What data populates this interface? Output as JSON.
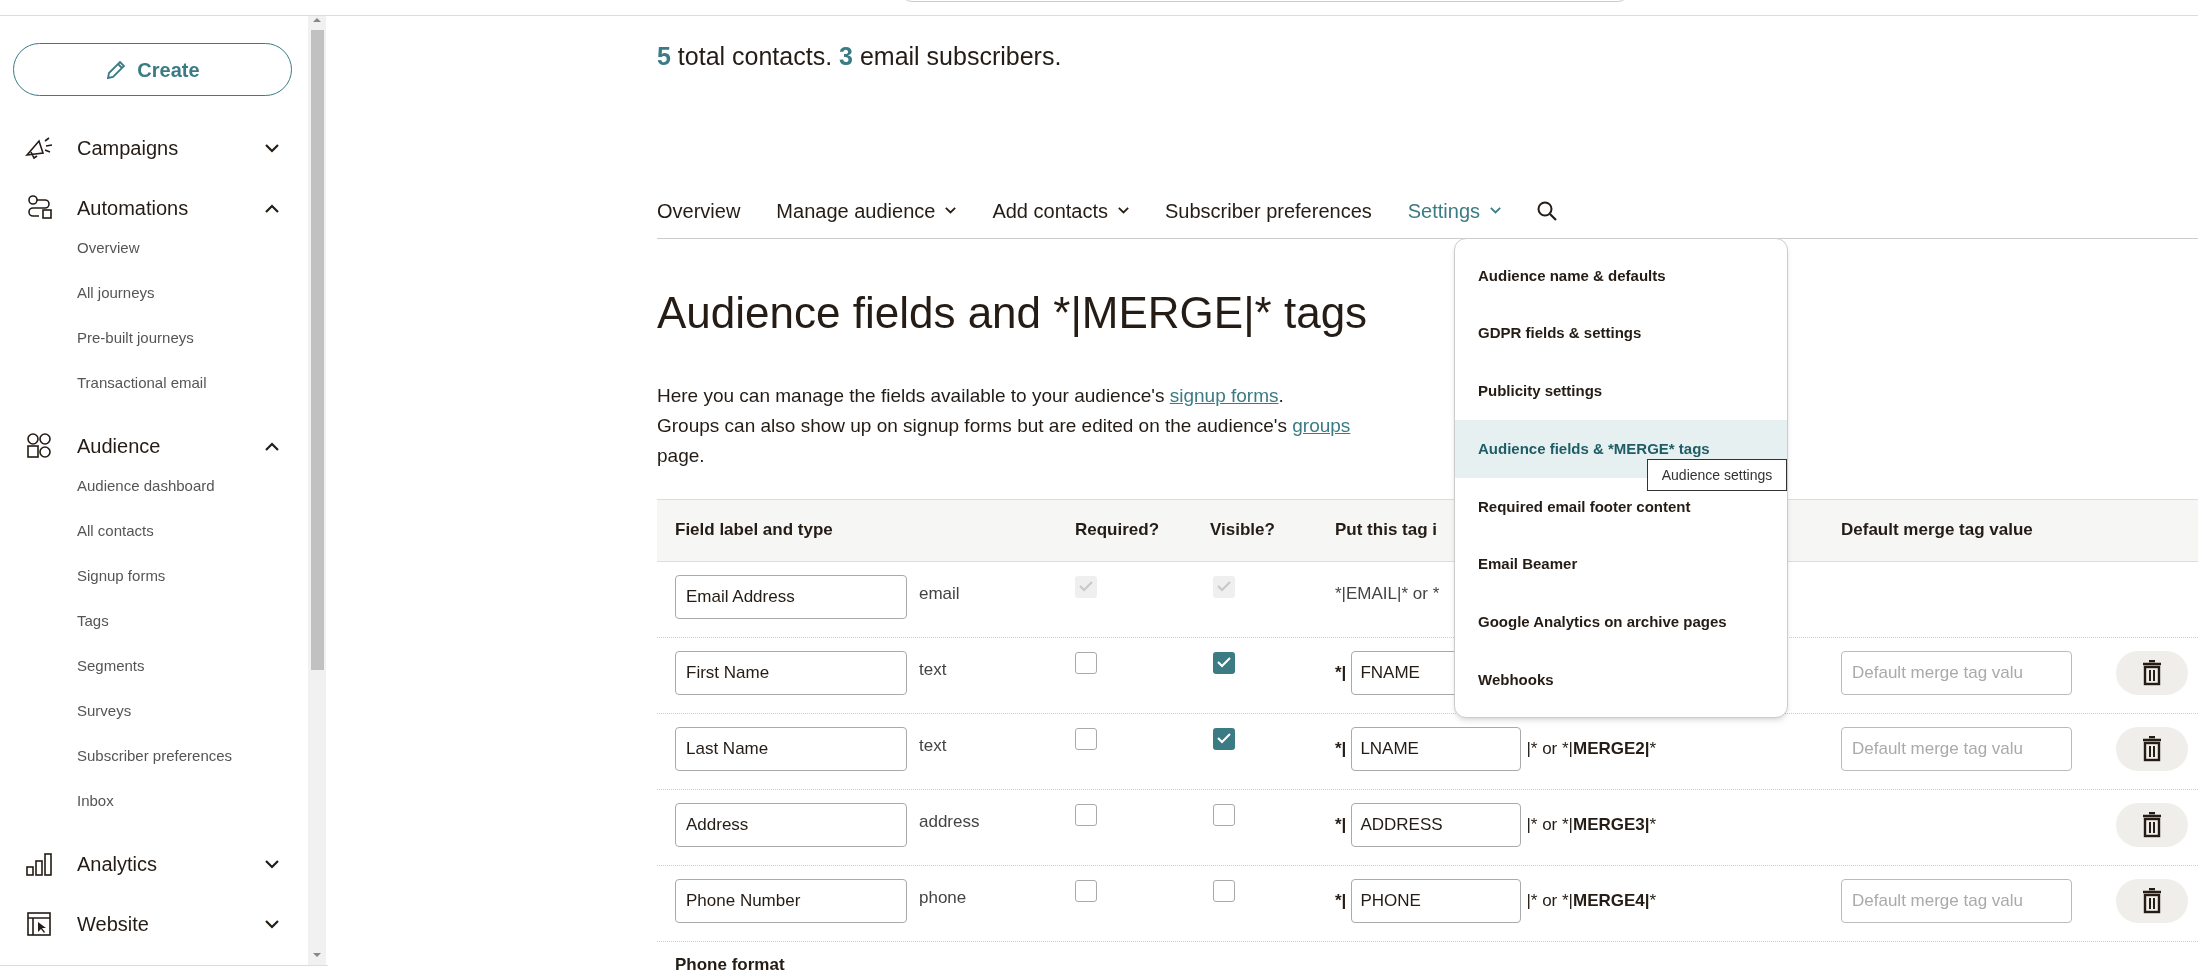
{
  "sidebar": {
    "create_button": "Create",
    "sections": [
      {
        "label": "Campaigns",
        "expanded": false
      },
      {
        "label": "Automations",
        "expanded": true,
        "children": [
          {
            "label": "Overview"
          },
          {
            "label": "All journeys"
          },
          {
            "label": "Pre-built journeys"
          },
          {
            "label": "Transactional email"
          }
        ]
      },
      {
        "label": "Audience",
        "expanded": true,
        "children": [
          {
            "label": "Audience dashboard"
          },
          {
            "label": "All contacts"
          },
          {
            "label": "Signup forms"
          },
          {
            "label": "Tags"
          },
          {
            "label": "Segments"
          },
          {
            "label": "Surveys"
          },
          {
            "label": "Subscriber preferences"
          },
          {
            "label": "Inbox"
          }
        ]
      },
      {
        "label": "Analytics",
        "expanded": false
      },
      {
        "label": "Website",
        "expanded": false
      }
    ]
  },
  "summary": "**5** total contacts. **3** email subscribers.",
  "tabs": [
    {
      "label": "Overview",
      "selected": false,
      "has_menu": false
    },
    {
      "label": "Manage audience",
      "selected": false,
      "has_menu": true
    },
    {
      "label": "Add contacts",
      "selected": false,
      "has_menu": true
    },
    {
      "label": "Subscriber preferences",
      "selected": false,
      "has_menu": false
    },
    {
      "label": "Settings",
      "selected": true,
      "has_menu": true
    }
  ],
  "settings_menu": {
    "items": [
      {
        "label": "Audience name & defaults",
        "selected": false
      },
      {
        "label": "GDPR fields & settings",
        "selected": false
      },
      {
        "label": "Publicity settings",
        "selected": false
      },
      {
        "label": "Audience fields & *MERGE* tags",
        "selected": true
      },
      {
        "label": "Required email footer content",
        "selected": false
      },
      {
        "label": "Email Beamer",
        "selected": false
      },
      {
        "label": "Google Analytics on archive pages",
        "selected": false
      },
      {
        "label": "Webhooks",
        "selected": false
      }
    ],
    "tooltip": "Audience settings"
  },
  "heading": "Audience fields and *|MERGE|* tags",
  "intro": [
    [
      {
        "text": "Here you can manage the fields available to your audience's "
      },
      {
        "text": "signup forms",
        "link": true
      },
      {
        "text": "."
      }
    ],
    [
      {
        "text": "Groups can also show up on signup forms but are edited on the audience's "
      },
      {
        "text": "groups",
        "link": true
      },
      {
        "text": " page."
      }
    ]
  ],
  "table": {
    "columns": [
      "Field label and type",
      "Required?",
      "Visible?",
      "Put this tag i",
      "Default merge tag value"
    ],
    "rows": [
      {
        "kind": "locked",
        "label": "Email Address",
        "type": "email",
        "required": true,
        "visible": true,
        "tag_text": "*|EMAIL|* or *"
      },
      {
        "label": "First Name",
        "type": "text",
        "kind": "editable",
        "required": false,
        "visible": true,
        "tag_prefix": "*|",
        "tag": "FNAME",
        "default_placeholder": "Default merge tag valu",
        "deletable": true
      },
      {
        "label": "Last Name",
        "type": "text",
        "kind": "editable",
        "required": false,
        "visible": true,
        "tag_prefix": "*|",
        "tag": "LNAME",
        "tag_suffix": "|* or *|**MERGE2|***",
        "default_placeholder": "Default merge tag valu",
        "deletable": true
      },
      {
        "label": "Address",
        "type": "address",
        "kind": "editable",
        "required": false,
        "visible": false,
        "tag_prefix": "*|",
        "tag": "ADDRESS",
        "tag_suffix": "|* or *|**MERGE3|***",
        "deletable": true
      },
      {
        "label": "Phone Number",
        "type": "phone",
        "kind": "editable",
        "required": false,
        "visible": false,
        "tag_prefix": "*|",
        "tag": "PHONE",
        "tag_suffix": "|* or *|**MERGE4|***",
        "default_placeholder": "Default merge tag valu",
        "deletable": true
      }
    ]
  },
  "footer_label": "Phone format"
}
